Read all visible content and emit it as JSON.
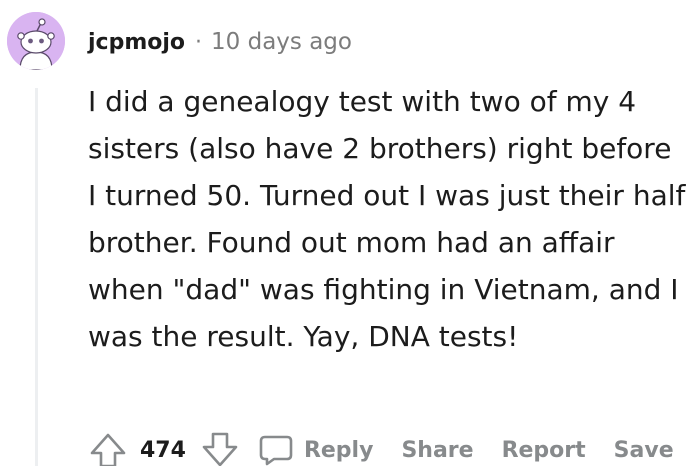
{
  "comment": {
    "author": "jcpmojo",
    "separator": "·",
    "timestamp": "10 days ago",
    "body": "I did a genealogy test with two of my 4 sisters (also have 2 brothers) right before I turned 50. Turned out I was just their half brother. Found out mom had an affair when \"dad\" was fighting in Vietnam, and I was the result. Yay, DNA tests!",
    "score": "474"
  },
  "actions": {
    "reply": "Reply",
    "share": "Share",
    "report": "Report",
    "save": "Save"
  },
  "icons": {
    "avatar": "snoo-avatar-icon",
    "upvote": "upvote-arrow-icon",
    "downvote": "downvote-arrow-icon",
    "reply": "comment-bubble-icon"
  },
  "colors": {
    "avatar_background": "#d9b4f1",
    "muted_text": "#7c7c7c",
    "action_text": "#878a8c",
    "thread_line": "#edeff1"
  }
}
